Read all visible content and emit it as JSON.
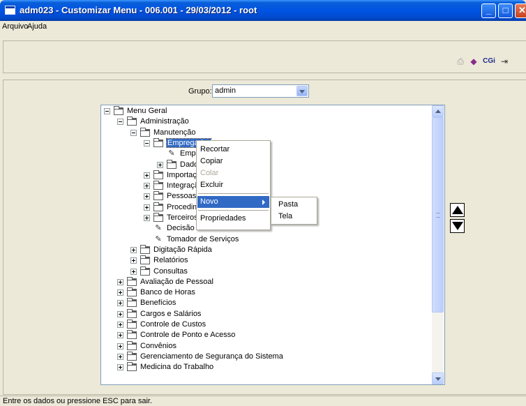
{
  "window": {
    "title": "adm023 - Customizar Menu - 006.001 - 29/03/2012 - root",
    "buttons": [
      "minimize-icon",
      "maximize-icon",
      "close-icon"
    ]
  },
  "menubar": {
    "items": [
      "Arquivo",
      "Ajuda"
    ]
  },
  "toolbar": {
    "icons": [
      "printer-icon",
      "eraser-icon",
      "cgi-logo",
      "exit-door-icon"
    ],
    "cgi_label": "CGi"
  },
  "grupo": {
    "label": "Grupo:",
    "value": "admin"
  },
  "tree": {
    "nodes": [
      {
        "label": "Menu Geral",
        "level": 0,
        "type": "folder",
        "expander": "minus"
      },
      {
        "label": "Administração",
        "level": 1,
        "type": "folder",
        "expander": "minus"
      },
      {
        "label": "Manutenção",
        "level": 2,
        "type": "folder",
        "expander": "minus"
      },
      {
        "label": "Empregador",
        "level": 3,
        "type": "folder-open",
        "expander": "minus",
        "selected": true
      },
      {
        "label": "Empregador",
        "level": 4,
        "type": "doc",
        "expander": "none"
      },
      {
        "label": "Dados",
        "level": 4,
        "type": "folder",
        "expander": "plus"
      },
      {
        "label": "Importação",
        "level": 3,
        "type": "folder",
        "expander": "plus"
      },
      {
        "label": "Integração",
        "level": 3,
        "type": "folder",
        "expander": "plus"
      },
      {
        "label": "Pessoas",
        "level": 3,
        "type": "folder",
        "expander": "plus"
      },
      {
        "label": "Procedimentos",
        "level": 3,
        "type": "folder",
        "expander": "plus"
      },
      {
        "label": "Terceiros",
        "level": 3,
        "type": "folder",
        "expander": "plus"
      },
      {
        "label": "Decisão Contábil",
        "level": 3,
        "type": "doc",
        "expander": "none"
      },
      {
        "label": "Tomador de Serviços",
        "level": 3,
        "type": "doc",
        "expander": "none"
      },
      {
        "label": "Digitação Rápida",
        "level": 2,
        "type": "folder",
        "expander": "plus"
      },
      {
        "label": "Relatórios",
        "level": 2,
        "type": "folder",
        "expander": "plus"
      },
      {
        "label": "Consultas",
        "level": 2,
        "type": "folder",
        "expander": "plus"
      },
      {
        "label": "Avaliação de Pessoal",
        "level": 1,
        "type": "folder",
        "expander": "plus"
      },
      {
        "label": "Banco de Horas",
        "level": 1,
        "type": "folder",
        "expander": "plus"
      },
      {
        "label": "Benefícios",
        "level": 1,
        "type": "folder",
        "expander": "plus"
      },
      {
        "label": "Cargos e Salários",
        "level": 1,
        "type": "folder",
        "expander": "plus"
      },
      {
        "label": "Controle de Custos",
        "level": 1,
        "type": "folder",
        "expander": "plus"
      },
      {
        "label": "Controle de Ponto e Acesso",
        "level": 1,
        "type": "folder",
        "expander": "plus"
      },
      {
        "label": "Convênios",
        "level": 1,
        "type": "folder",
        "expander": "plus"
      },
      {
        "label": "Gerenciamento de Segurança do Sistema",
        "level": 1,
        "type": "folder",
        "expander": "plus"
      },
      {
        "label": "Medicina do Trabalho",
        "level": 1,
        "type": "folder",
        "expander": "plus"
      }
    ]
  },
  "context_menu": {
    "items": [
      {
        "label": "Recortar",
        "state": "normal"
      },
      {
        "label": "Copiar",
        "state": "normal"
      },
      {
        "label": "Colar",
        "state": "disabled"
      },
      {
        "label": "Excluir",
        "state": "normal"
      },
      {
        "separator": true
      },
      {
        "label": "Novo",
        "state": "highlighted",
        "submenu": true
      },
      {
        "separator": true
      },
      {
        "label": "Propriedades",
        "state": "normal"
      }
    ]
  },
  "submenu": {
    "items": [
      "Pasta",
      "Tela"
    ]
  },
  "move_buttons": [
    "move-up-icon",
    "move-down-icon"
  ],
  "status": {
    "text": "Entre os dados ou pressione ESC para sair."
  },
  "colors": {
    "titlebar": "#0054E3",
    "selection": "#316AC5",
    "window_bg": "#ECE9D8"
  }
}
